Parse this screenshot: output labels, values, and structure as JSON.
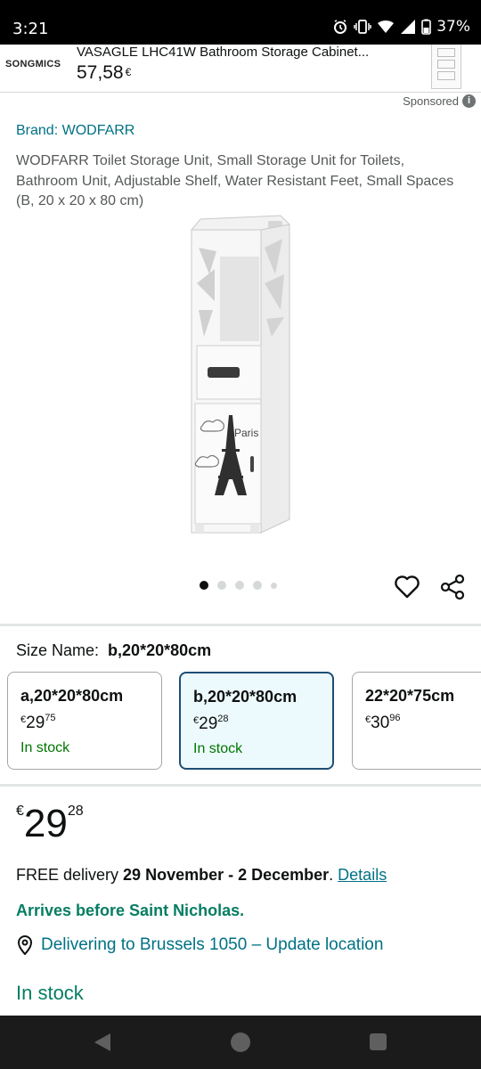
{
  "status_bar": {
    "time": "3:21",
    "battery": "37%",
    "icons": [
      "alarm-icon",
      "vibrate-icon",
      "wifi-icon",
      "signal-icon",
      "battery-icon"
    ]
  },
  "sponsored_banner": {
    "brand_logo": "SONGMICS",
    "title": "VASAGLE LHC41W Bathroom Storage Cabinet...",
    "price": "57,58",
    "currency": "€"
  },
  "sponsored_label": "Sponsored",
  "product": {
    "brand_link": "Brand: WODFARR",
    "title": "WODFARR Toilet Storage Unit, Small Storage Unit for Toilets, Bathroom Unit, Adjustable Shelf, Water Resistant Feet, Small Spaces (B, 20 x 20 x 80 cm)",
    "image_text": "Paris",
    "carousel_dots": 5,
    "active_dot": 0
  },
  "size_selector": {
    "label": "Size Name:",
    "selected_value": "b,20*20*80cm",
    "options": [
      {
        "label": "a,20*20*80cm",
        "currency": "€",
        "whole": "29",
        "fraction": "75",
        "stock": "In stock",
        "selected": false
      },
      {
        "label": "b,20*20*80cm",
        "currency": "€",
        "whole": "29",
        "fraction": "28",
        "stock": "In stock",
        "selected": true
      },
      {
        "label": "22*20*75cm",
        "currency": "€",
        "whole": "30",
        "fraction": "96",
        "stock": "",
        "selected": false
      }
    ]
  },
  "price": {
    "currency": "€",
    "whole": "29",
    "fraction": "28"
  },
  "delivery": {
    "prefix": "FREE delivery ",
    "dates": "29 November - 2 December",
    "suffix": ". ",
    "details_link": "Details"
  },
  "arrives_note": "Arrives before Saint Nicholas.",
  "location": "Delivering to Brussels 1050 – Update location",
  "stock_status": "In stock",
  "colors": {
    "link": "#007185",
    "in_stock_green": "#067d62",
    "selected_border": "#1d4e74",
    "selected_bg": "#edfafd"
  }
}
